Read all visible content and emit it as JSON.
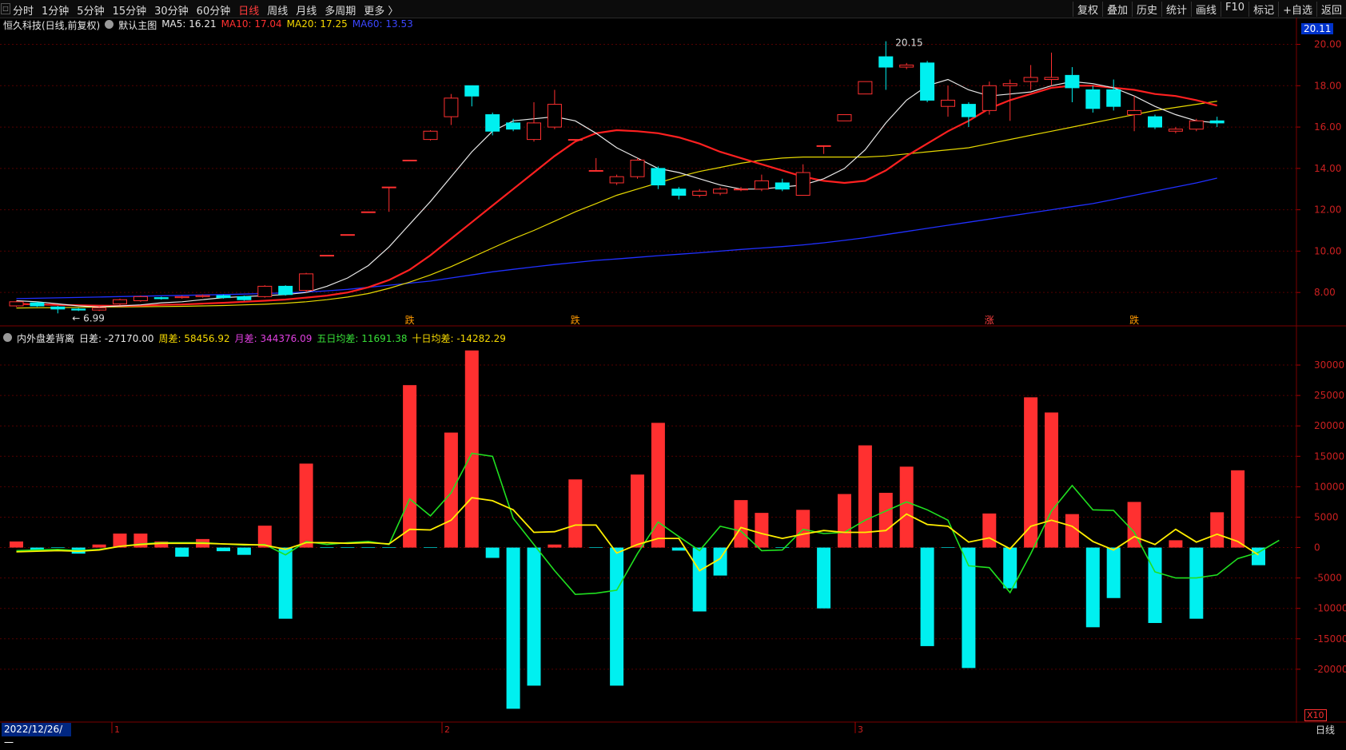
{
  "toolbar": {
    "left_items": [
      "分时",
      "1分钟",
      "5分钟",
      "15分钟",
      "30分钟",
      "60分钟",
      "日线",
      "周线",
      "月线",
      "多周期",
      "更多 〉"
    ],
    "active_item": "日线",
    "right_items": [
      "复权",
      "叠加",
      "历史",
      "统计",
      "画线",
      "F10",
      "标记",
      "+自选",
      "返回"
    ]
  },
  "main_panel": {
    "stock_label": "恒久科技(日线,前复权)",
    "template_label": "默认主图",
    "ma_items": [
      {
        "text": "MA5: 16.21",
        "color": "#e8e8e8"
      },
      {
        "text": "MA10: 17.04",
        "color": "#ff3030"
      },
      {
        "text": "MA20: 17.25",
        "color": "#f5d800"
      },
      {
        "text": "MA60: 13.53",
        "color": "#3b46ff"
      }
    ],
    "price_tag": "20.11",
    "high_label": "20.15",
    "low_label": "6.99",
    "markers": [
      "跌",
      "跌",
      "涨",
      "跌"
    ]
  },
  "sub_panel": {
    "indicator_label": "内外盘差背离",
    "items": [
      {
        "text": "日差: -27170.00",
        "color": "#e8e8e8"
      },
      {
        "text": "周差: 58456.92",
        "color": "#f5d800"
      },
      {
        "text": "月差: 344376.09",
        "color": "#e040e0"
      },
      {
        "text": "五日均差: 11691.38",
        "color": "#38e038"
      },
      {
        "text": "十日均差: -14282.29",
        "color": "#f5d800"
      }
    ],
    "scale_badge": "X10"
  },
  "footer": {
    "date": "2022/12/26/一",
    "period": "日线",
    "month_marks": [
      "1",
      "2",
      "3"
    ]
  },
  "colors": {
    "up": "#ff3030",
    "down": "#00f0f0",
    "ma5": "#e8e8e8",
    "ma10": "#ff2020",
    "ma20": "#e6d800",
    "ma60": "#2030ff",
    "grid": "#550000"
  },
  "chart_data": [
    {
      "type": "candlestick",
      "y_ticks": [
        8.0,
        10.0,
        12.0,
        14.0,
        16.0,
        18.0,
        20.0
      ],
      "ylim": [
        6.5,
        20.6
      ],
      "candles": [
        {
          "o": 7.35,
          "c": 7.55,
          "h": 7.6,
          "l": 7.3
        },
        {
          "o": 7.5,
          "c": 7.35,
          "h": 7.55,
          "l": 7.3
        },
        {
          "o": 7.3,
          "c": 7.2,
          "h": 7.35,
          "l": 6.99
        },
        {
          "o": 7.2,
          "c": 7.15,
          "h": 7.25,
          "l": 7.1
        },
        {
          "o": 7.15,
          "c": 7.25,
          "h": 7.3,
          "l": 7.1
        },
        {
          "o": 7.45,
          "c": 7.65,
          "h": 7.7,
          "l": 7.4
        },
        {
          "o": 7.6,
          "c": 7.8,
          "h": 7.85,
          "l": 7.55
        },
        {
          "o": 7.75,
          "c": 7.7,
          "h": 7.8,
          "l": 7.65
        },
        {
          "o": 7.75,
          "c": 7.8,
          "h": 7.85,
          "l": 7.7
        },
        {
          "o": 7.8,
          "c": 7.85,
          "h": 7.9,
          "l": 7.75
        },
        {
          "o": 7.85,
          "c": 7.75,
          "h": 7.9,
          "l": 7.7
        },
        {
          "o": 7.8,
          "c": 7.65,
          "h": 7.85,
          "l": 7.6
        },
        {
          "o": 7.8,
          "c": 8.3,
          "h": 8.35,
          "l": 7.75
        },
        {
          "o": 8.3,
          "c": 7.9,
          "h": 8.35,
          "l": 7.85
        },
        {
          "o": 8.1,
          "c": 8.9,
          "h": 8.95,
          "l": 8.0
        },
        {
          "o": 9.8,
          "c": 9.8,
          "h": 9.8,
          "l": 9.8
        },
        {
          "o": 10.8,
          "c": 10.8,
          "h": 10.8,
          "l": 10.8
        },
        {
          "o": 11.9,
          "c": 11.9,
          "h": 11.9,
          "l": 11.9
        },
        {
          "o": 13.1,
          "c": 13.1,
          "h": 13.1,
          "l": 11.9
        },
        {
          "o": 14.4,
          "c": 14.4,
          "h": 14.4,
          "l": 14.4
        },
        {
          "o": 15.4,
          "c": 15.8,
          "h": 15.85,
          "l": 15.35
        },
        {
          "o": 16.5,
          "c": 17.4,
          "h": 17.6,
          "l": 16.1
        },
        {
          "o": 18.0,
          "c": 17.5,
          "h": 18.0,
          "l": 17.0
        },
        {
          "o": 16.6,
          "c": 15.8,
          "h": 16.7,
          "l": 15.6
        },
        {
          "o": 16.2,
          "c": 15.9,
          "h": 16.4,
          "l": 15.8
        },
        {
          "o": 15.4,
          "c": 16.2,
          "h": 17.2,
          "l": 15.3
        },
        {
          "o": 16.0,
          "c": 17.1,
          "h": 17.8,
          "l": 15.9
        },
        {
          "o": 15.4,
          "c": 15.4,
          "h": 15.4,
          "l": 15.4
        },
        {
          "o": 13.9,
          "c": 13.9,
          "h": 14.5,
          "l": 13.9
        },
        {
          "o": 13.3,
          "c": 13.6,
          "h": 13.7,
          "l": 13.2
        },
        {
          "o": 13.6,
          "c": 14.4,
          "h": 14.5,
          "l": 13.5
        },
        {
          "o": 14.0,
          "c": 13.2,
          "h": 14.1,
          "l": 13.0
        },
        {
          "o": 13.0,
          "c": 12.7,
          "h": 13.1,
          "l": 12.5
        },
        {
          "o": 12.7,
          "c": 12.9,
          "h": 13.0,
          "l": 12.6
        },
        {
          "o": 12.8,
          "c": 13.0,
          "h": 13.1,
          "l": 12.7
        },
        {
          "o": 13.0,
          "c": 13.0,
          "h": 13.1,
          "l": 12.9
        },
        {
          "o": 13.0,
          "c": 13.4,
          "h": 13.7,
          "l": 12.9
        },
        {
          "o": 13.3,
          "c": 13.0,
          "h": 13.5,
          "l": 12.9
        },
        {
          "o": 12.7,
          "c": 13.8,
          "h": 14.2,
          "l": 12.7
        },
        {
          "o": 15.1,
          "c": 15.1,
          "h": 15.1,
          "l": 14.7
        },
        {
          "o": 16.3,
          "c": 16.6,
          "h": 16.6,
          "l": 16.3
        },
        {
          "o": 17.6,
          "c": 18.2,
          "h": 18.2,
          "l": 17.6
        },
        {
          "o": 19.4,
          "c": 18.9,
          "h": 20.15,
          "l": 17.8
        },
        {
          "o": 18.9,
          "c": 19.0,
          "h": 19.1,
          "l": 18.8
        },
        {
          "o": 19.1,
          "c": 17.3,
          "h": 19.2,
          "l": 17.2
        },
        {
          "o": 17.0,
          "c": 17.3,
          "h": 18.0,
          "l": 16.5
        },
        {
          "o": 17.1,
          "c": 16.5,
          "h": 17.2,
          "l": 16.0
        },
        {
          "o": 16.8,
          "c": 18.0,
          "h": 18.2,
          "l": 16.6
        },
        {
          "o": 18.0,
          "c": 18.1,
          "h": 18.3,
          "l": 16.3
        },
        {
          "o": 18.2,
          "c": 18.4,
          "h": 19.0,
          "l": 17.8
        },
        {
          "o": 18.3,
          "c": 18.4,
          "h": 19.6,
          "l": 18.0
        },
        {
          "o": 18.5,
          "c": 17.9,
          "h": 18.9,
          "l": 17.2
        },
        {
          "o": 17.8,
          "c": 16.9,
          "h": 18.0,
          "l": 16.7
        },
        {
          "o": 17.8,
          "c": 17.0,
          "h": 18.3,
          "l": 16.8
        },
        {
          "o": 16.6,
          "c": 16.8,
          "h": 17.5,
          "l": 15.8
        },
        {
          "o": 16.5,
          "c": 16.0,
          "h": 16.6,
          "l": 15.9
        },
        {
          "o": 15.8,
          "c": 15.9,
          "h": 16.0,
          "l": 15.7
        },
        {
          "o": 15.9,
          "c": 16.3,
          "h": 16.4,
          "l": 15.8
        },
        {
          "o": 16.3,
          "c": 16.2,
          "h": 16.5,
          "l": 16.0
        }
      ],
      "ma5": [
        7.6,
        7.55,
        7.45,
        7.35,
        7.3,
        7.35,
        7.4,
        7.5,
        7.55,
        7.65,
        7.75,
        7.8,
        7.85,
        7.9,
        8.0,
        8.3,
        8.7,
        9.3,
        10.2,
        11.3,
        12.4,
        13.6,
        14.8,
        15.8,
        16.3,
        16.4,
        16.5,
        16.3,
        15.7,
        15.0,
        14.5,
        14.0,
        13.8,
        13.5,
        13.2,
        13.0,
        13.0,
        13.1,
        13.2,
        13.5,
        14.0,
        14.9,
        16.2,
        17.3,
        18.0,
        18.3,
        17.8,
        17.5,
        17.6,
        17.7,
        18.0,
        18.2,
        18.1,
        17.9,
        17.5,
        17.0,
        16.6,
        16.3,
        16.2
      ],
      "ma10": [
        7.45,
        7.42,
        7.4,
        7.38,
        7.36,
        7.35,
        7.36,
        7.4,
        7.42,
        7.46,
        7.5,
        7.55,
        7.6,
        7.66,
        7.75,
        7.85,
        8.0,
        8.25,
        8.6,
        9.1,
        9.8,
        10.6,
        11.4,
        12.2,
        13.0,
        13.8,
        14.6,
        15.3,
        15.7,
        15.85,
        15.8,
        15.7,
        15.5,
        15.2,
        14.8,
        14.5,
        14.2,
        13.9,
        13.6,
        13.4,
        13.3,
        13.4,
        13.9,
        14.6,
        15.2,
        15.8,
        16.3,
        16.9,
        17.3,
        17.6,
        17.9,
        18.0,
        18.0,
        17.9,
        17.8,
        17.6,
        17.5,
        17.3,
        17.04
      ],
      "ma20": [
        7.25,
        7.26,
        7.27,
        7.28,
        7.3,
        7.3,
        7.31,
        7.32,
        7.33,
        7.35,
        7.37,
        7.4,
        7.43,
        7.48,
        7.55,
        7.65,
        7.78,
        7.95,
        8.2,
        8.5,
        8.85,
        9.25,
        9.7,
        10.15,
        10.6,
        11.0,
        11.45,
        11.9,
        12.3,
        12.7,
        13.0,
        13.3,
        13.6,
        13.85,
        14.05,
        14.25,
        14.4,
        14.5,
        14.55,
        14.55,
        14.55,
        14.55,
        14.6,
        14.7,
        14.8,
        14.9,
        15.0,
        15.2,
        15.4,
        15.6,
        15.8,
        16.0,
        16.2,
        16.4,
        16.6,
        16.8,
        16.95,
        17.1,
        17.25
      ],
      "ma60": [
        7.7,
        7.72,
        7.74,
        7.76,
        7.78,
        7.8,
        7.82,
        7.84,
        7.86,
        7.88,
        7.9,
        7.92,
        7.95,
        7.98,
        8.02,
        8.08,
        8.15,
        8.25,
        8.35,
        8.45,
        8.55,
        8.7,
        8.85,
        9.0,
        9.12,
        9.24,
        9.35,
        9.45,
        9.55,
        9.62,
        9.7,
        9.78,
        9.85,
        9.92,
        10.0,
        10.08,
        10.15,
        10.22,
        10.3,
        10.4,
        10.52,
        10.65,
        10.8,
        10.95,
        11.1,
        11.25,
        11.4,
        11.55,
        11.7,
        11.85,
        12.0,
        12.15,
        12.3,
        12.5,
        12.7,
        12.9,
        13.1,
        13.3,
        13.53
      ]
    },
    {
      "type": "bar",
      "y_ticks": [
        -20000,
        -15000,
        -10000,
        -5000,
        0,
        5000,
        10000,
        15000,
        20000,
        25000,
        30000
      ],
      "ylim": [
        -27500,
        32500
      ],
      "values": [
        1000,
        -500,
        0,
        -1000,
        500,
        2300,
        2300,
        1000,
        -1500,
        1400,
        -600,
        -1200,
        3600,
        -11700,
        13800,
        0,
        0,
        0,
        0,
        26700,
        0,
        18900,
        32400,
        -1700,
        -26500,
        -22700,
        500,
        11200,
        0,
        -22700,
        12000,
        20500,
        -500,
        -10500,
        -4600,
        7800,
        5700,
        0,
        6200,
        -10000,
        8800,
        16800,
        9000,
        13300,
        -16200,
        0,
        -19800,
        5600,
        -6700,
        24700,
        22200,
        5500,
        -13100,
        -8300,
        7500,
        -12400,
        1200,
        -11700,
        5800,
        12700,
        -2900
      ],
      "wu_ri": [
        -500,
        -400,
        -300,
        -500,
        -300,
        200,
        600,
        800,
        800,
        800,
        600,
        400,
        500,
        -1200,
        1000,
        500,
        800,
        1000,
        500,
        8000,
        5200,
        9000,
        15500,
        15000,
        4800,
        500,
        -3800,
        -7700,
        -7500,
        -7000,
        -1000,
        4200,
        1800,
        -500,
        3500,
        2700,
        -500,
        -400,
        3000,
        2300,
        2500,
        4500,
        6000,
        7500,
        6200,
        4500,
        -3000,
        -3300,
        -7400,
        -1000,
        6000,
        10200,
        6200,
        6100,
        2500,
        -4000,
        -5000,
        -5000,
        -4500,
        -1800,
        -800,
        1200
      ],
      "shi_ri": [
        -700,
        -600,
        -500,
        -600,
        -400,
        200,
        500,
        700,
        700,
        700,
        600,
        500,
        400,
        -300,
        800,
        800,
        700,
        800,
        600,
        3000,
        2900,
        4500,
        8200,
        7700,
        6200,
        2500,
        2600,
        3700,
        3700,
        -900,
        500,
        1500,
        1500,
        -3800,
        -1800,
        3300,
        2300,
        1500,
        2200,
        2800,
        2500,
        2500,
        2800,
        5500,
        3800,
        3500,
        900,
        1600,
        -200,
        3500,
        4500,
        3500,
        1000,
        -400,
        1800,
        500,
        3000,
        900,
        2200,
        1000,
        -1200
      ]
    }
  ]
}
